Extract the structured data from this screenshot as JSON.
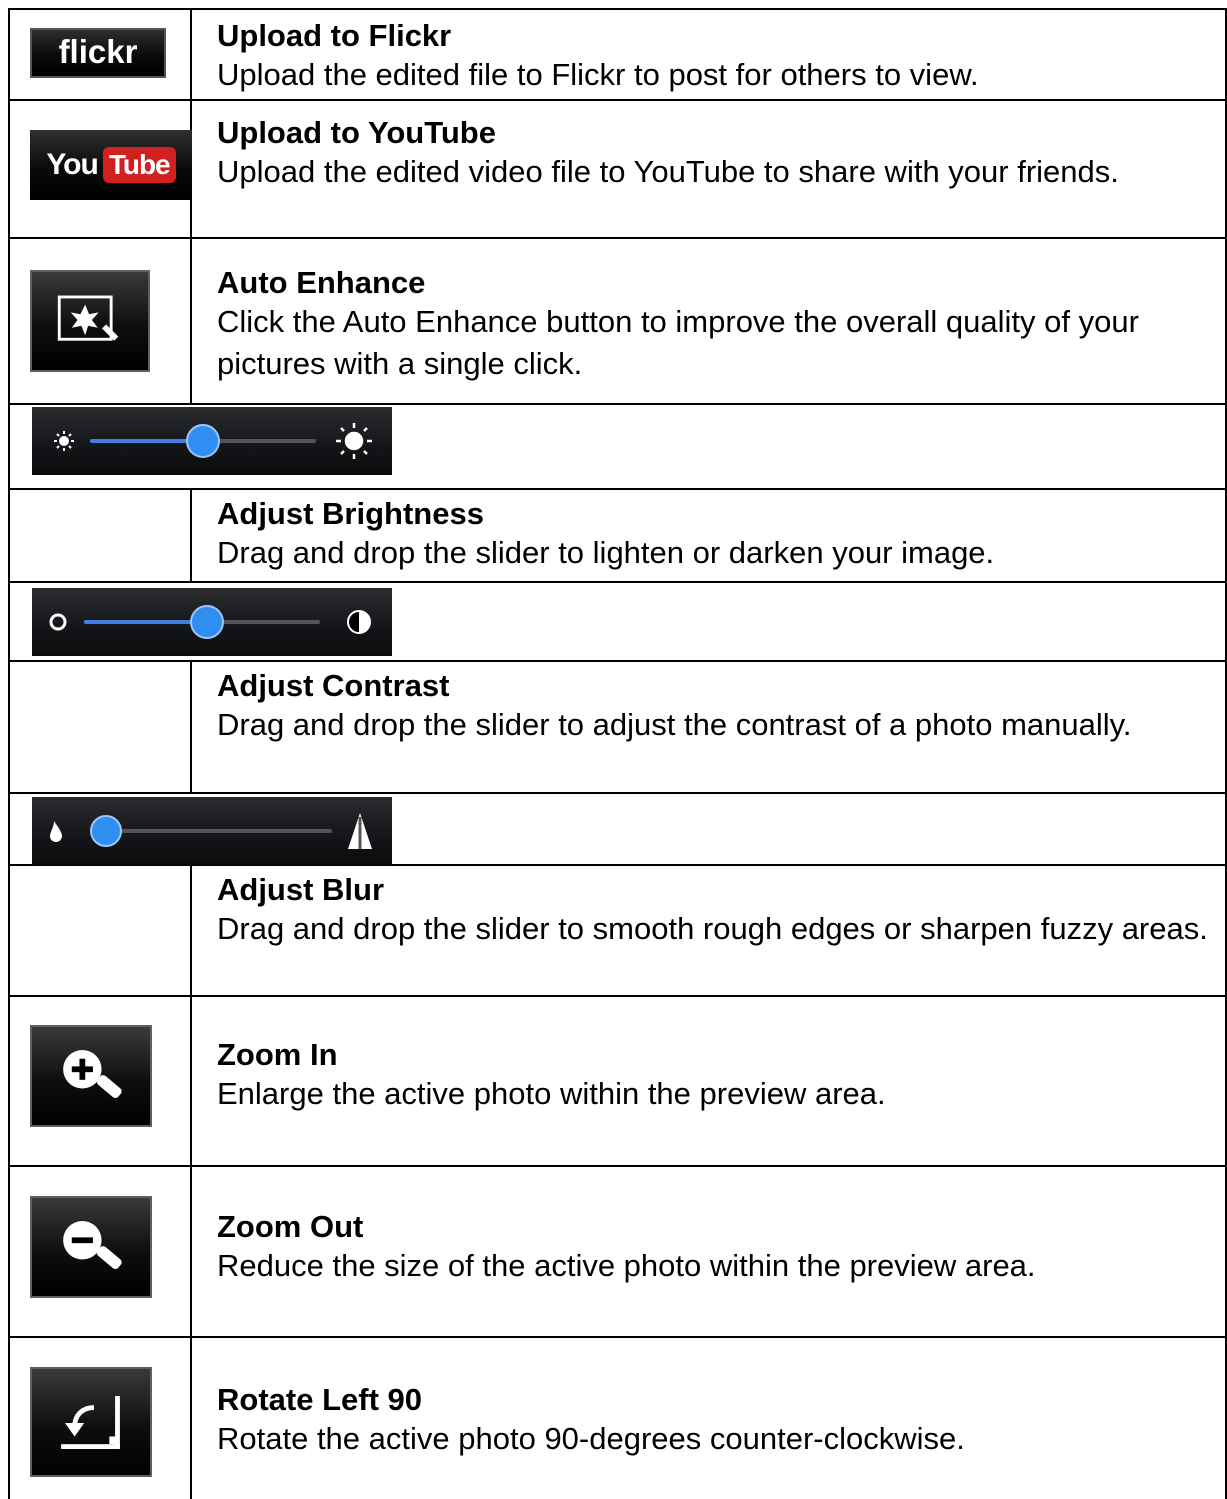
{
  "rows": [
    {
      "icon": "flickr-logo-icon",
      "logo_text": "flickr",
      "title": "Upload to Flickr",
      "description": "Upload the edited file to Flickr to post for others to view."
    },
    {
      "icon": "youtube-logo-icon",
      "logo_you": "You",
      "logo_tube": "Tube",
      "title": "Upload to YouTube",
      "description": "Upload the edited video file to YouTube to share with your friends."
    },
    {
      "icon": "auto-enhance-icon",
      "title": "Auto Enhance",
      "description": "Click the Auto Enhance button to improve the overall quality of your pictures with a single click."
    },
    {
      "icon": "brightness-slider",
      "slider_level_percent": 50,
      "title": "Adjust Brightness",
      "description": "Drag and drop the slider to lighten or darken your image."
    },
    {
      "icon": "contrast-slider",
      "slider_level_percent": 50,
      "title": "Adjust Contrast",
      "description": "Drag and drop the slider to adjust the contrast of a photo manually."
    },
    {
      "icon": "blur-slider",
      "slider_level_percent": 0,
      "title": "Adjust Blur",
      "description": "Drag and drop the slider to smooth rough edges or sharpen fuzzy areas."
    },
    {
      "icon": "zoom-in-icon",
      "title": "Zoom In",
      "description": "Enlarge the active photo within the preview area."
    },
    {
      "icon": "zoom-out-icon",
      "title": "Zoom Out",
      "description": "Reduce the size of the active photo within the preview area."
    },
    {
      "icon": "rotate-left-icon",
      "title": "Rotate Left 90",
      "description": "Rotate the active photo 90-degrees counter-clockwise."
    }
  ],
  "colors": {
    "slider_fill": "#3f7fe0",
    "knob": "#2f8ff0",
    "youtube_red": "#d12020"
  }
}
